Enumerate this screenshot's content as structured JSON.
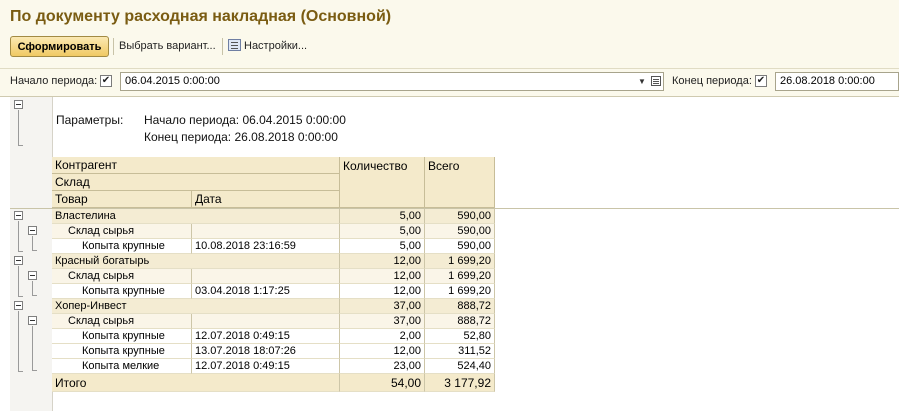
{
  "window": {
    "title": "По документу расходная накладная (Основной)"
  },
  "toolbar": {
    "generate_label": "Сформировать",
    "variant_label": "Выбрать вариант...",
    "settings_label": "Настройки..."
  },
  "period": {
    "start_label": "Начало периода:",
    "start_checked": "✔",
    "start_value": "06.04.2015  0:00:00",
    "end_label": "Конец периода:",
    "end_checked": "✔",
    "end_value": "26.08.2018  0:00:00"
  },
  "report": {
    "params_label": "Параметры:",
    "param_start": "Начало периода: 06.04.2015 0:00:00",
    "param_end": "Конец периода: 26.08.2018 0:00:00",
    "headers": {
      "counterparty": "Контрагент",
      "warehouse": "Склад",
      "product": "Товар",
      "date": "Дата",
      "quantity": "Количество",
      "total": "Всего"
    },
    "rows": [
      {
        "level": 1,
        "name": "Властелина",
        "date": "",
        "qty": "5,00",
        "sum": "590,00"
      },
      {
        "level": 2,
        "name": "Склад сырья",
        "date": "",
        "qty": "5,00",
        "sum": "590,00"
      },
      {
        "level": 3,
        "name": "Копыта крупные",
        "date": "10.08.2018 23:16:59",
        "qty": "5,00",
        "sum": "590,00"
      },
      {
        "level": 1,
        "name": "Красный богатырь",
        "date": "",
        "qty": "12,00",
        "sum": "1 699,20"
      },
      {
        "level": 2,
        "name": "Склад сырья",
        "date": "",
        "qty": "12,00",
        "sum": "1 699,20"
      },
      {
        "level": 3,
        "name": "Копыта крупные",
        "date": "03.04.2018 1:17:25",
        "qty": "12,00",
        "sum": "1 699,20"
      },
      {
        "level": 1,
        "name": "Хопер-Инвест",
        "date": "",
        "qty": "37,00",
        "sum": "888,72"
      },
      {
        "level": 2,
        "name": "Склад сырья",
        "date": "",
        "qty": "37,00",
        "sum": "888,72"
      },
      {
        "level": 3,
        "name": "Копыта крупные",
        "date": "12.07.2018 0:49:15",
        "qty": "2,00",
        "sum": "52,80"
      },
      {
        "level": 3,
        "name": "Копыта крупные",
        "date": "13.07.2018 18:07:26",
        "qty": "12,00",
        "sum": "311,52"
      },
      {
        "level": 3,
        "name": "Копыта мелкие",
        "date": "12.07.2018 0:49:15",
        "qty": "23,00",
        "sum": "524,40"
      }
    ],
    "total": {
      "label": "Итого",
      "qty": "54,00",
      "sum": "3 177,92"
    }
  },
  "colors": {
    "title": "#7a5c12",
    "header_bg": "#f4eacb",
    "accent_button": "#f0c964"
  }
}
